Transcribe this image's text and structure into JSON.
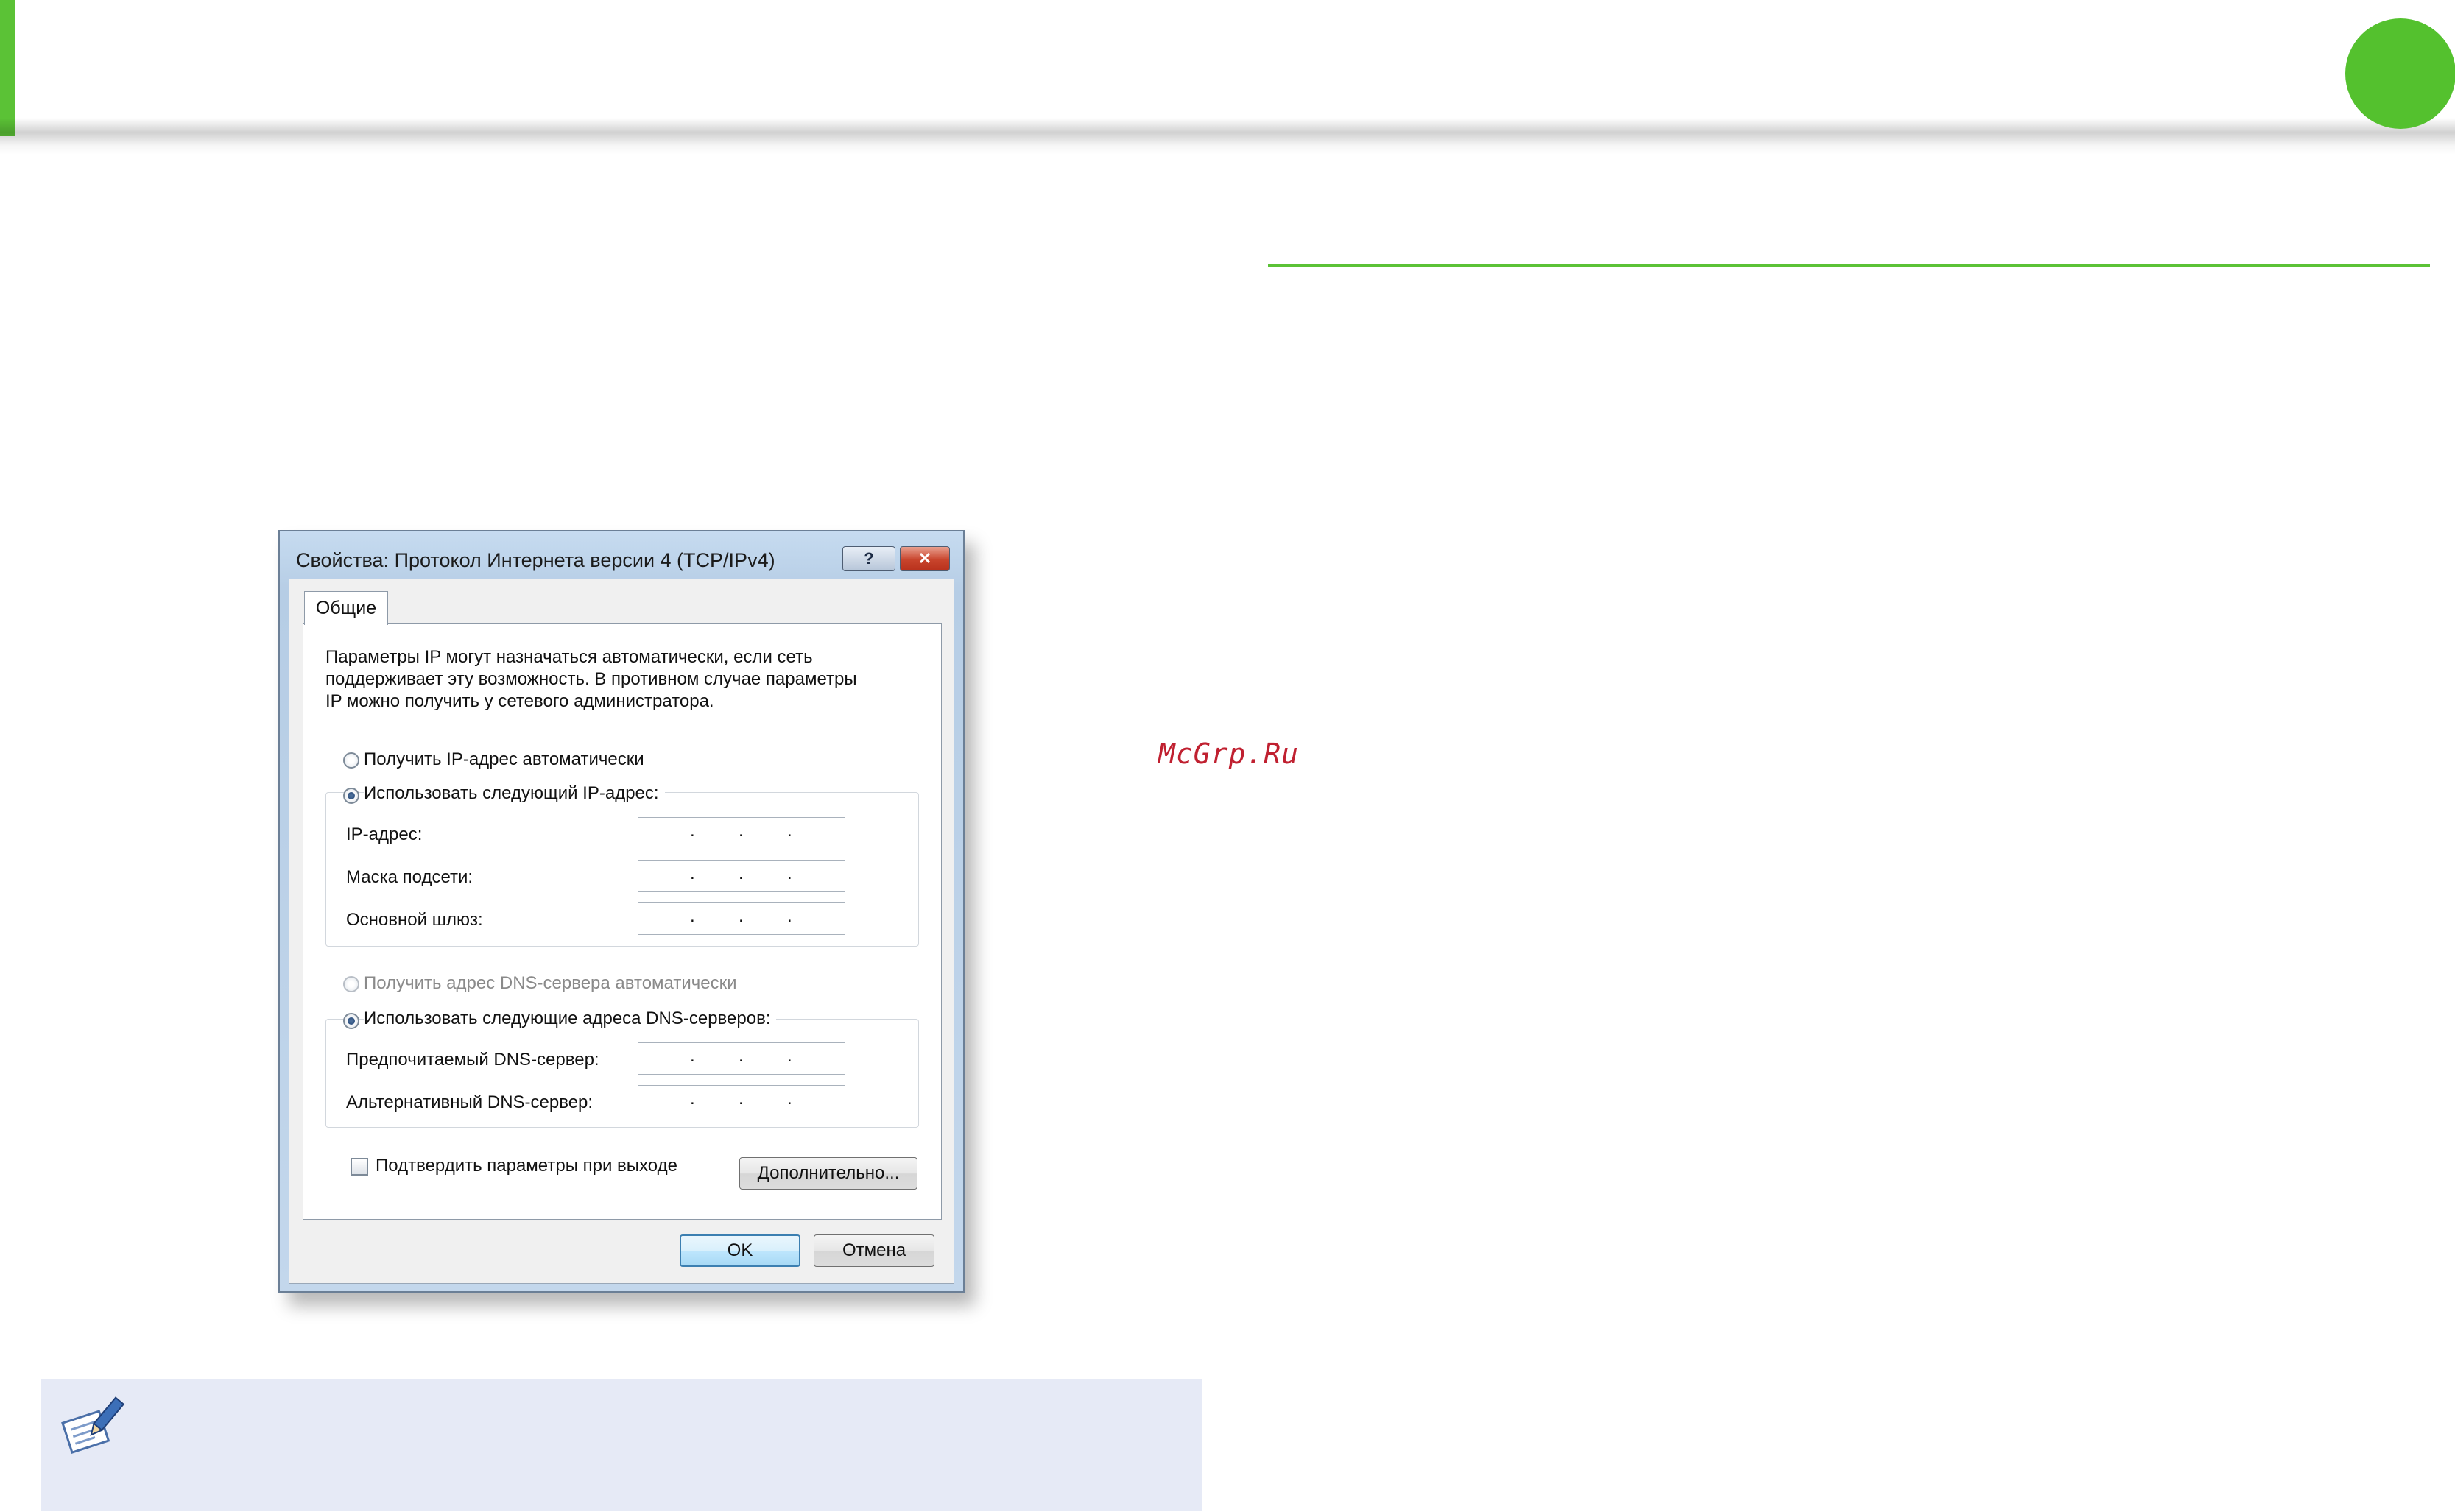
{
  "watermark": "McGrp.Ru",
  "icons": [
    "pencil-note-icon",
    "help-icon",
    "close-icon"
  ],
  "colors": {
    "accent_green": "#5bc236",
    "note_background": "#e6eaf6"
  },
  "dialog": {
    "title": "Свойства: Протокол Интернета версии 4 (TCP/IPv4)",
    "help_label": "?",
    "close_label": "✕",
    "tab_label": "Общие",
    "description": [
      "Параметры IP могут назначаться автоматически, если сеть",
      "поддерживает эту возможность. В противном случае параметры",
      "IP можно получить у сетевого администратора."
    ],
    "ip_auto_label": "Получить IP-адрес автоматически",
    "ip_manual_label": "Использовать следующий IP-адрес:",
    "ip_fields": {
      "ip_label": "IP-адрес:",
      "mask_label": "Маска подсети:",
      "gateway_label": "Основной шлюз:"
    },
    "dns_auto_label": "Получить адрес DNS-сервера автоматически",
    "dns_manual_label": "Использовать следующие адреса DNS-серверов:",
    "dns_fields": {
      "preferred_label": "Предпочитаемый DNS-сервер:",
      "alternate_label": "Альтернативный DNS-сервер:"
    },
    "ip_dot": ".",
    "validate_label": "Подтвердить параметры при выходе",
    "advanced_label": "Дополнительно...",
    "ok_label": "OK",
    "cancel_label": "Отмена"
  }
}
